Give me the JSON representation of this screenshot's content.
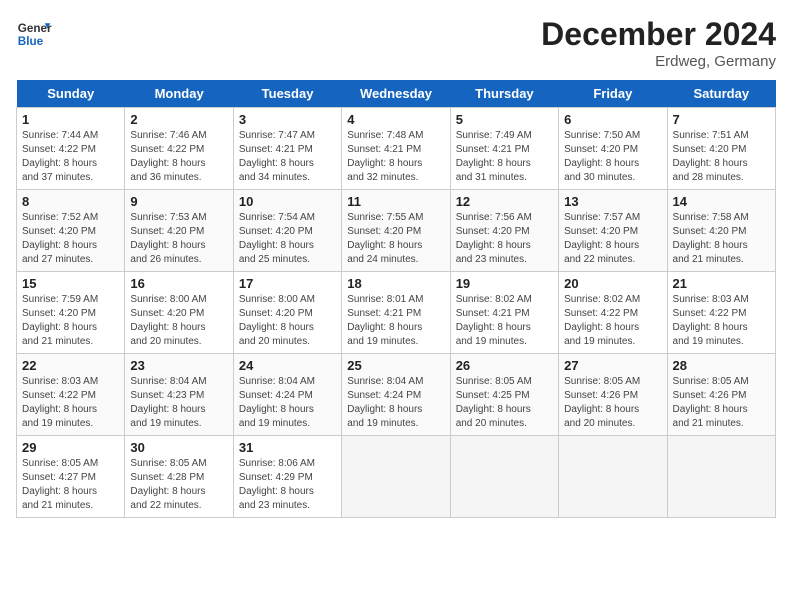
{
  "header": {
    "logo_line1": "General",
    "logo_line2": "Blue",
    "month": "December 2024",
    "location": "Erdweg, Germany"
  },
  "days_of_week": [
    "Sunday",
    "Monday",
    "Tuesday",
    "Wednesday",
    "Thursday",
    "Friday",
    "Saturday"
  ],
  "weeks": [
    [
      {
        "day": "1",
        "info": "Sunrise: 7:44 AM\nSunset: 4:22 PM\nDaylight: 8 hours\nand 37 minutes."
      },
      {
        "day": "2",
        "info": "Sunrise: 7:46 AM\nSunset: 4:22 PM\nDaylight: 8 hours\nand 36 minutes."
      },
      {
        "day": "3",
        "info": "Sunrise: 7:47 AM\nSunset: 4:21 PM\nDaylight: 8 hours\nand 34 minutes."
      },
      {
        "day": "4",
        "info": "Sunrise: 7:48 AM\nSunset: 4:21 PM\nDaylight: 8 hours\nand 32 minutes."
      },
      {
        "day": "5",
        "info": "Sunrise: 7:49 AM\nSunset: 4:21 PM\nDaylight: 8 hours\nand 31 minutes."
      },
      {
        "day": "6",
        "info": "Sunrise: 7:50 AM\nSunset: 4:20 PM\nDaylight: 8 hours\nand 30 minutes."
      },
      {
        "day": "7",
        "info": "Sunrise: 7:51 AM\nSunset: 4:20 PM\nDaylight: 8 hours\nand 28 minutes."
      }
    ],
    [
      {
        "day": "8",
        "info": "Sunrise: 7:52 AM\nSunset: 4:20 PM\nDaylight: 8 hours\nand 27 minutes."
      },
      {
        "day": "9",
        "info": "Sunrise: 7:53 AM\nSunset: 4:20 PM\nDaylight: 8 hours\nand 26 minutes."
      },
      {
        "day": "10",
        "info": "Sunrise: 7:54 AM\nSunset: 4:20 PM\nDaylight: 8 hours\nand 25 minutes."
      },
      {
        "day": "11",
        "info": "Sunrise: 7:55 AM\nSunset: 4:20 PM\nDaylight: 8 hours\nand 24 minutes."
      },
      {
        "day": "12",
        "info": "Sunrise: 7:56 AM\nSunset: 4:20 PM\nDaylight: 8 hours\nand 23 minutes."
      },
      {
        "day": "13",
        "info": "Sunrise: 7:57 AM\nSunset: 4:20 PM\nDaylight: 8 hours\nand 22 minutes."
      },
      {
        "day": "14",
        "info": "Sunrise: 7:58 AM\nSunset: 4:20 PM\nDaylight: 8 hours\nand 21 minutes."
      }
    ],
    [
      {
        "day": "15",
        "info": "Sunrise: 7:59 AM\nSunset: 4:20 PM\nDaylight: 8 hours\nand 21 minutes."
      },
      {
        "day": "16",
        "info": "Sunrise: 8:00 AM\nSunset: 4:20 PM\nDaylight: 8 hours\nand 20 minutes."
      },
      {
        "day": "17",
        "info": "Sunrise: 8:00 AM\nSunset: 4:20 PM\nDaylight: 8 hours\nand 20 minutes."
      },
      {
        "day": "18",
        "info": "Sunrise: 8:01 AM\nSunset: 4:21 PM\nDaylight: 8 hours\nand 19 minutes."
      },
      {
        "day": "19",
        "info": "Sunrise: 8:02 AM\nSunset: 4:21 PM\nDaylight: 8 hours\nand 19 minutes."
      },
      {
        "day": "20",
        "info": "Sunrise: 8:02 AM\nSunset: 4:22 PM\nDaylight: 8 hours\nand 19 minutes."
      },
      {
        "day": "21",
        "info": "Sunrise: 8:03 AM\nSunset: 4:22 PM\nDaylight: 8 hours\nand 19 minutes."
      }
    ],
    [
      {
        "day": "22",
        "info": "Sunrise: 8:03 AM\nSunset: 4:22 PM\nDaylight: 8 hours\nand 19 minutes."
      },
      {
        "day": "23",
        "info": "Sunrise: 8:04 AM\nSunset: 4:23 PM\nDaylight: 8 hours\nand 19 minutes."
      },
      {
        "day": "24",
        "info": "Sunrise: 8:04 AM\nSunset: 4:24 PM\nDaylight: 8 hours\nand 19 minutes."
      },
      {
        "day": "25",
        "info": "Sunrise: 8:04 AM\nSunset: 4:24 PM\nDaylight: 8 hours\nand 19 minutes."
      },
      {
        "day": "26",
        "info": "Sunrise: 8:05 AM\nSunset: 4:25 PM\nDaylight: 8 hours\nand 20 minutes."
      },
      {
        "day": "27",
        "info": "Sunrise: 8:05 AM\nSunset: 4:26 PM\nDaylight: 8 hours\nand 20 minutes."
      },
      {
        "day": "28",
        "info": "Sunrise: 8:05 AM\nSunset: 4:26 PM\nDaylight: 8 hours\nand 21 minutes."
      }
    ],
    [
      {
        "day": "29",
        "info": "Sunrise: 8:05 AM\nSunset: 4:27 PM\nDaylight: 8 hours\nand 21 minutes."
      },
      {
        "day": "30",
        "info": "Sunrise: 8:05 AM\nSunset: 4:28 PM\nDaylight: 8 hours\nand 22 minutes."
      },
      {
        "day": "31",
        "info": "Sunrise: 8:06 AM\nSunset: 4:29 PM\nDaylight: 8 hours\nand 23 minutes."
      },
      {
        "day": "",
        "info": ""
      },
      {
        "day": "",
        "info": ""
      },
      {
        "day": "",
        "info": ""
      },
      {
        "day": "",
        "info": ""
      }
    ]
  ]
}
